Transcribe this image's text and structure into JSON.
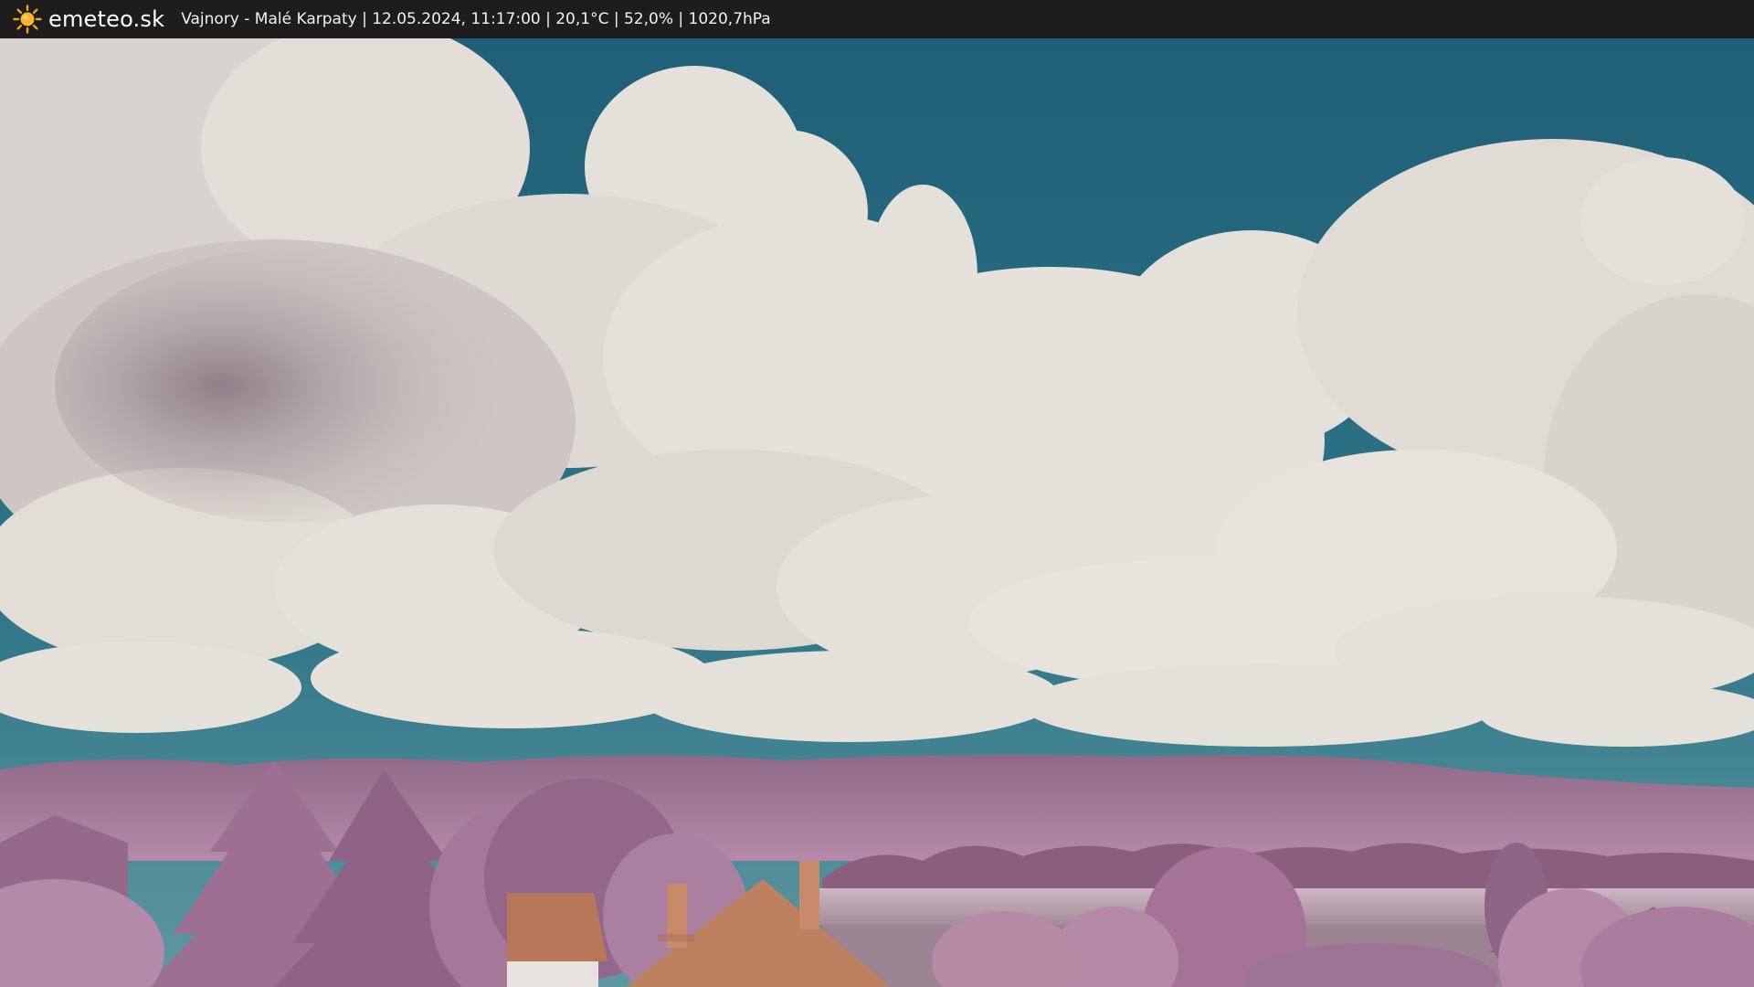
{
  "header": {
    "brand": "emeteo.sk",
    "logo_icon": "sun-icon",
    "info": "Vajnory - Malé Karpaty | 12.05.2024, 11:17:00 | 20,1°C | 52,0% | 1020,7hPa",
    "background_color": "#1d1d1d"
  },
  "scene": {
    "subject": "webcam view: cumulus clouds over teal sky, purple-tinted hills, trees and rooftops",
    "colors": {
      "sky": "#2f6f86",
      "cloud": "#e6e3dd",
      "hills": "#9e7392",
      "trees": "#a87a9c",
      "roof": "#b9795c"
    }
  }
}
